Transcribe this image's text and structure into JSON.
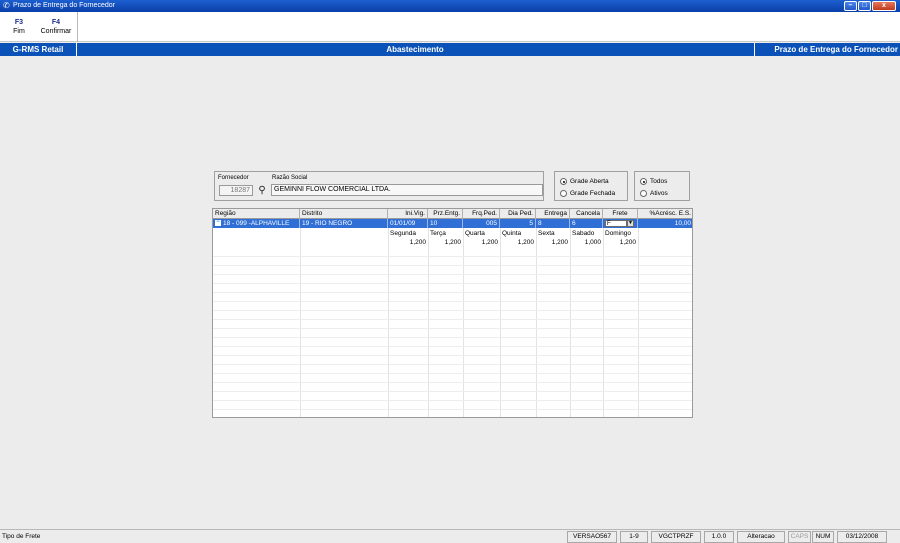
{
  "window": {
    "title": "Prazo de Entrega do Fornecedor",
    "minimize": "–",
    "maximize": "□",
    "close": "x"
  },
  "toolbar": {
    "buttons": [
      {
        "key": "F3",
        "label": "Fim"
      },
      {
        "key": "F4",
        "label": "Confirmar"
      }
    ]
  },
  "header": {
    "left": "G-RMS Retail",
    "center": "Abastecimento",
    "right": "Prazo de Entrega do Fornecedor"
  },
  "supplier": {
    "fornecedor_label": "Fornecedor",
    "razao_label": "Razão Social",
    "code": "18287",
    "razao_social": "GEMINNI FLOW COMERCIAL LTDA.",
    "search_icon": "binoculars-icon"
  },
  "grade_options": {
    "aberta": "Grade Aberta",
    "fechada": "Grade Fechada",
    "selected": "aberta"
  },
  "filter_options": {
    "todos": "Todos",
    "ativos": "Ativos",
    "selected": "todos"
  },
  "grid": {
    "columns": [
      "Região",
      "Distrito",
      "Ini.Vig.",
      "Prz.Entg.",
      "Frq.Ped.",
      "Dia Ped.",
      "Entrega",
      "Cancela",
      "Frete",
      "%Acrésc. E.S."
    ],
    "row": {
      "regiao": "18 - 099 -ALPHAVILLE",
      "distrito": "19 - RIO NEGRO",
      "ini_vig": "01/01/09",
      "prz_entg": "10",
      "frq_ped": "005",
      "dia_ped": "5",
      "entrega": "8",
      "cancela": "6",
      "frete": "F",
      "acresc": "10,00"
    },
    "days_header": [
      "Segunda",
      "Terça",
      "Quarta",
      "Quinta",
      "Sexta",
      "Sabado",
      "Domingo"
    ],
    "days_values": [
      "1,200",
      "1,200",
      "1,200",
      "1,200",
      "1,200",
      "1,000",
      "1,200"
    ]
  },
  "statusbar": {
    "message": "Tipo de Frete",
    "panels": [
      "VERSAO567",
      "1-9",
      "VGCTPRZF",
      "1.0.0",
      "Alteracao",
      "CAPS",
      "NUM",
      "03/12/2008"
    ]
  }
}
